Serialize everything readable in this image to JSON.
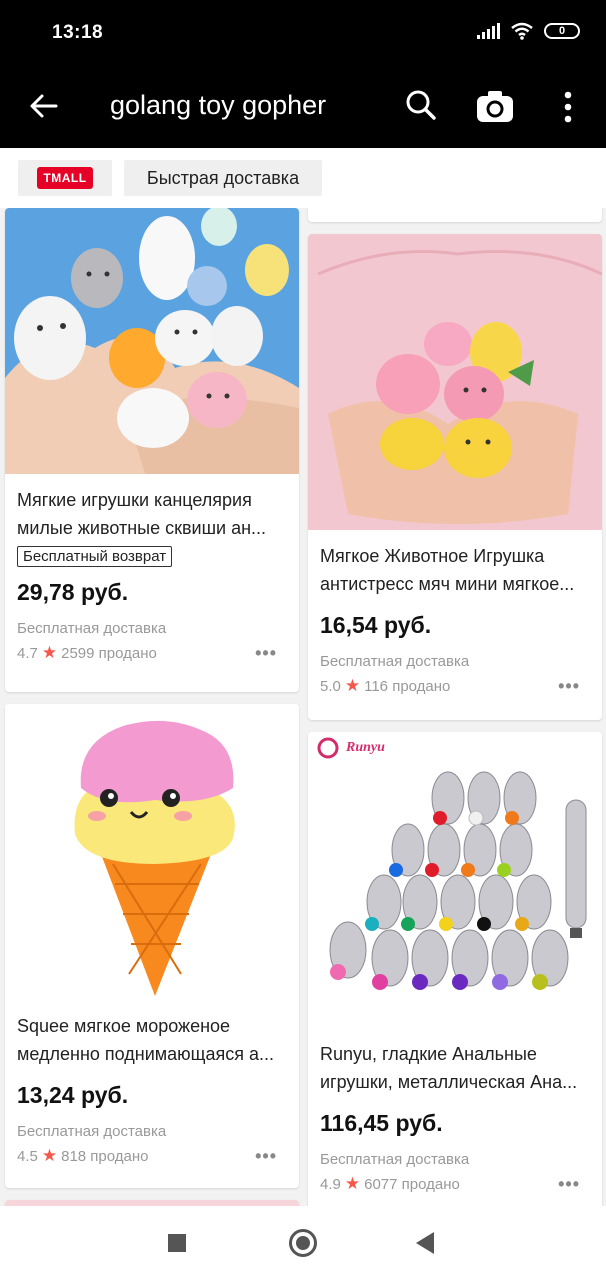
{
  "status_bar": {
    "time": "13:18",
    "battery": "0",
    "icons": [
      "signal-icon",
      "wifi-icon",
      "battery-icon"
    ]
  },
  "header": {
    "query": "golang toy gopher",
    "icons": [
      "back-arrow-icon",
      "search-icon",
      "camera-icon",
      "more-vertical-icon"
    ]
  },
  "filters": {
    "tmall": "TMALL",
    "fast_delivery": "Быстрая доставка"
  },
  "products": [
    {
      "title_line1": "Мягкие игрушки канцелярия",
      "title_line2": "милые животные сквиши ан...",
      "badge": "Бесплатный возврат",
      "price": "29,78 руб.",
      "delivery": "Бесплатная доставка",
      "rating": "4.7",
      "sold": "2599 продано"
    },
    {
      "title_line1": "Мягкое Животное Игрушка",
      "title_line2": "антистресс мяч мини мягкое...",
      "price": "16,54 руб.",
      "delivery": "Бесплатная доставка",
      "rating": "5.0",
      "sold": "116 продано"
    },
    {
      "title_line1": "Squee мягкое мороженое",
      "title_line2": "медленно поднимающаяся а...",
      "price": "13,24 руб.",
      "delivery": "Бесплатная доставка",
      "rating": "4.5",
      "sold": "818 продано"
    },
    {
      "brand": "Runyu",
      "title_line1": "Runyu, гладкие Анальные",
      "title_line2": "игрушки, металлическая Ана...",
      "price": "116,45 руб.",
      "delivery": "Бесплатная доставка",
      "rating": "4.9",
      "sold": "6077 продано"
    }
  ],
  "more_dots": "•••",
  "star": "★",
  "colors": {
    "brand_red": "#e60026",
    "star": "#f5574a",
    "header_bg": "#000000"
  },
  "nav": {
    "icons": [
      "recent-apps-icon",
      "home-icon",
      "back-icon"
    ]
  }
}
